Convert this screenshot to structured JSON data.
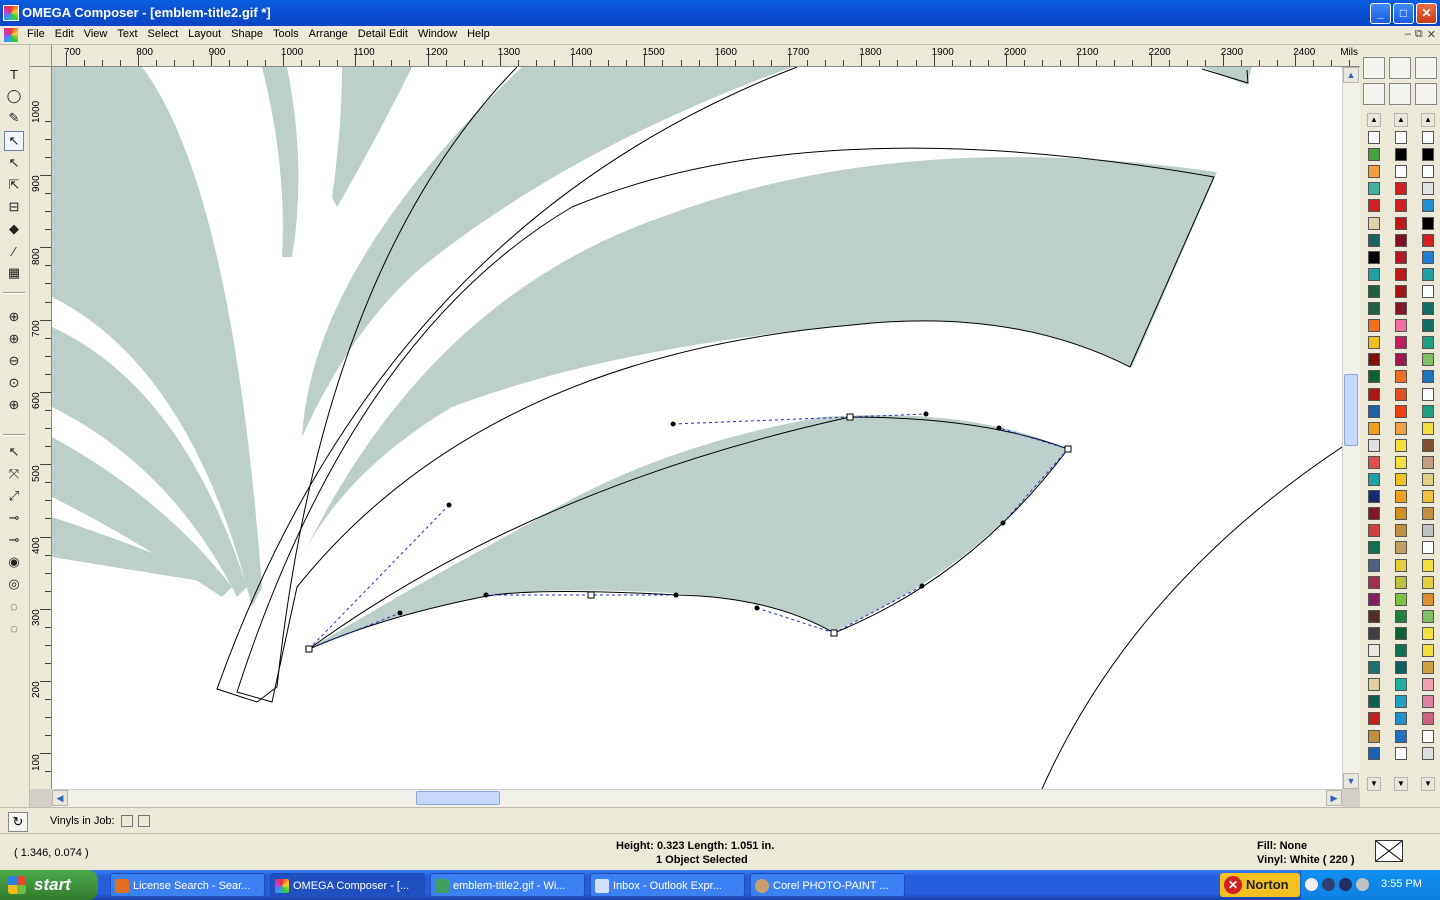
{
  "window": {
    "title": "OMEGA Composer - [emblem-title2.gif *]",
    "min": "_",
    "max": "□",
    "close": "✕"
  },
  "menu": {
    "items": [
      "File",
      "Edit",
      "View",
      "Text",
      "Select",
      "Layout",
      "Shape",
      "Tools",
      "Arrange",
      "Detail Edit",
      "Window",
      "Help"
    ],
    "mdi": [
      "–",
      "⧉",
      "✕"
    ]
  },
  "ruler": {
    "units": "Mils",
    "h_labels": [
      "700",
      "800",
      "900",
      "1000",
      "1100",
      "1200",
      "1300",
      "1400",
      "1500",
      "1600",
      "1700",
      "1800",
      "1900",
      "2000",
      "2100",
      "2200",
      "2300",
      "2400"
    ],
    "v_labels": [
      "1000",
      "900",
      "800",
      "700",
      "600",
      "500",
      "400",
      "300",
      "200",
      "100"
    ]
  },
  "toolbar": {
    "tools": [
      "text-tool",
      "ellipse-tool",
      "pen-tool",
      "node-edit-tool",
      "select-tool",
      "transform-tool",
      "measure-tool",
      "fill-tool",
      "eyedropper-tool",
      "pattern-tool",
      "zoom-tool",
      "zoom-in-tool",
      "zoom-out-tool",
      "zoom-fit-tool",
      "zoom-page-tool",
      "node-select-tool",
      "node-add-tool",
      "node-delete-tool",
      "node-join-tool",
      "node-break-tool",
      "weld-tool",
      "contour-tool",
      "outline-tool",
      "shadow-tool"
    ]
  },
  "vinyl": {
    "label": "Vinyls in Job:",
    "cycle_icon": "↻"
  },
  "status": {
    "coords": "( 1.346, 0.074 )",
    "dimensions": "Height: 0.323  Length: 1.051  in.",
    "selection": "1 Object Selected",
    "fill": "Fill: None",
    "vinyl": "Vinyl: White ( 220 )"
  },
  "taskbar": {
    "start": "start",
    "tasks": [
      "License Search - Sear...",
      "OMEGA Composer - [...",
      "emblem-title2.gif - Wi...",
      "Inbox - Outlook Expr...",
      "Corel PHOTO-PAINT ..."
    ],
    "norton": "Norton",
    "clock": "3:55 PM"
  },
  "colors": {
    "artwork_fill": "#bccfcb",
    "palette_col1": [
      "#ffffff",
      "#4aa040",
      "#f0a040",
      "#40b0a0",
      "#d02020",
      "#e0d0b0",
      "#1a6060",
      "#000000",
      "#20a0a0",
      "#206040",
      "#206048",
      "#f07020",
      "#f0c020",
      "#801010",
      "#106030",
      "#b01818",
      "#2060a0",
      "#f0a020",
      "#e0e0e0",
      "#e05050",
      "#20a0a0",
      "#1a2a70",
      "#801828",
      "#d04040",
      "#107050",
      "#506080",
      "#a03050",
      "#802060",
      "#503020",
      "#404040",
      "#e8e8e0",
      "#207070",
      "#e0d0a0",
      "#106050",
      "#c02020",
      "#c09040",
      "#2060b0"
    ],
    "palette_col2": [
      "#ffffff",
      "#000000",
      "#ffffff",
      "#d02020",
      "#d02020",
      "#c01818",
      "#801020",
      "#b01828",
      "#c01818",
      "#a01818",
      "#801828",
      "#f070a0",
      "#c02060",
      "#a01850",
      "#f07020",
      "#e05020",
      "#f04010",
      "#f0a040",
      "#f0e040",
      "#f0e040",
      "#f0c020",
      "#f0a020",
      "#d09020",
      "#c09040",
      "#c0a060",
      "#e0d040",
      "#c0c040",
      "#80c040",
      "#208040",
      "#106030",
      "#107050",
      "#106060",
      "#20b0a0",
      "#20a0c0",
      "#2090d0",
      "#2070c0",
      "#ffffff"
    ],
    "palette_col3": [
      "#ffffff",
      "#000000",
      "#ffffff",
      "#e0e0e0",
      "#2090d0",
      "#000000",
      "#d02020",
      "#2080d0",
      "#20a0a0",
      "#ffffff",
      "#107060",
      "#107060",
      "#20a080",
      "#80c060",
      "#2070c0",
      "#ffffff",
      "#20a080",
      "#f0e040",
      "#805030",
      "#c0a080",
      "#e0d080",
      "#f0c040",
      "#c09040",
      "#c0c0c0",
      "#ffffff",
      "#f0e040",
      "#e0d040",
      "#e09030",
      "#80c060",
      "#f0e040",
      "#f0e040",
      "#d0a040",
      "#f0a0b0",
      "#e080a0",
      "#d06080",
      "#ffffff",
      "#e0e0e0"
    ]
  }
}
